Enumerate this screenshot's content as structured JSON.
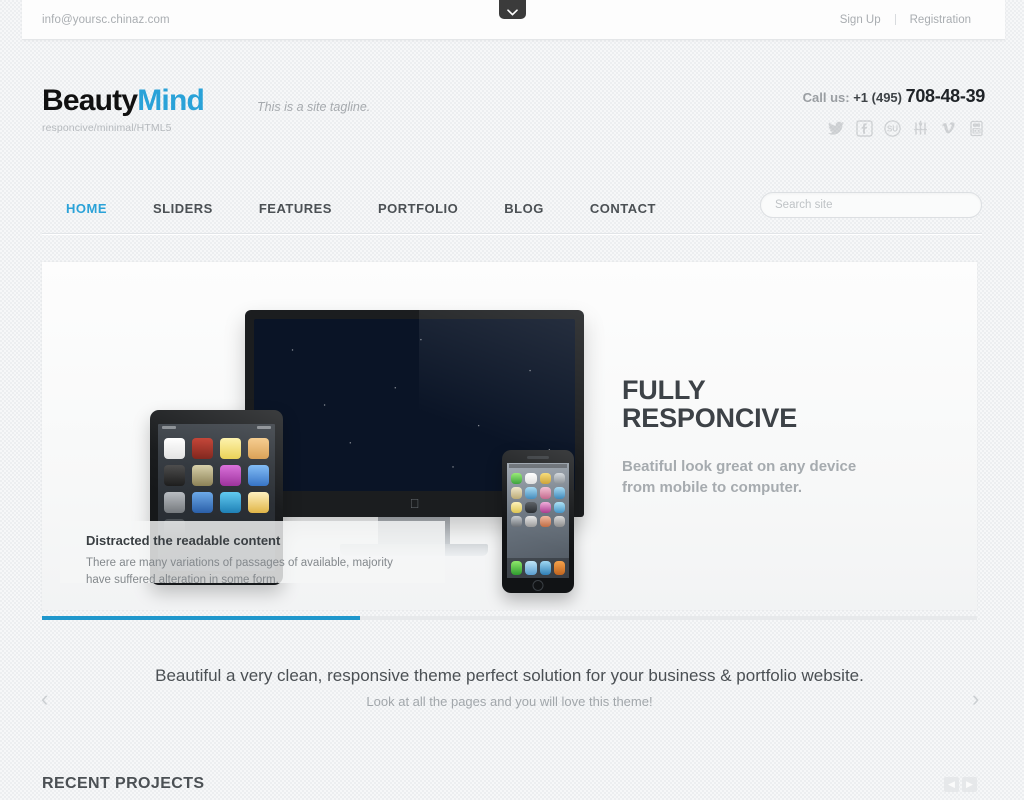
{
  "topbar": {
    "email": "info@yoursc.chinaz.com",
    "sign_up": "Sign Up",
    "registration": "Registration",
    "toggle_icon": "chevron-down-icon"
  },
  "header": {
    "logo_part1": "Beauty",
    "logo_part2": "Mind",
    "logo_sub": "responcive/minimal/HTML5",
    "tagline": "This is a site tagline.",
    "call_label": "Call us:",
    "call_code": "+1 (495)",
    "call_number": "708-48-39",
    "socials": [
      {
        "name": "twitter-icon"
      },
      {
        "name": "facebook-icon"
      },
      {
        "name": "stumbleupon-icon"
      },
      {
        "name": "dribbble-icon"
      },
      {
        "name": "vimeo-icon"
      },
      {
        "name": "youtube-icon"
      }
    ]
  },
  "nav": {
    "items": [
      {
        "label": "HOME",
        "active": true
      },
      {
        "label": "SLIDERS",
        "active": false
      },
      {
        "label": "FEATURES",
        "active": false
      },
      {
        "label": "PORTFOLIO",
        "active": false
      },
      {
        "label": "BLOG",
        "active": false
      },
      {
        "label": "CONTACT",
        "active": false
      }
    ],
    "search_placeholder": "Search site",
    "search_value": ""
  },
  "hero": {
    "title_line1": "FULLY",
    "title_line2": "RESPONCIVE",
    "subtitle_line1": "Beatiful look great on any device",
    "subtitle_line2": "from mobile to computer.",
    "caption_title": "Distracted the readable content",
    "caption_text_line1": "There are many variations of passages of available, majority",
    "caption_text_line2": "have suffered alteration in some form.",
    "progress_percent": 34,
    "devices": {
      "monitor": "imac-display",
      "tablet": "ipad-device",
      "phone": "iphone-device"
    }
  },
  "promo": {
    "line1": "Beautiful a very clean, responsive theme perfect solution for your business & portfolio website.",
    "line2": "Look at all the pages and you will love this theme!",
    "prev_icon": "chevron-left-icon",
    "next_icon": "chevron-right-icon"
  },
  "recent": {
    "title": "RECENT PROJECTS",
    "prev_icon": "chevron-left-icon",
    "next_icon": "chevron-right-icon"
  },
  "colors": {
    "accent": "#2aa2d8",
    "progress": "#1f97cc",
    "dark": "#3b3b3b",
    "text": "#4b5054",
    "muted": "#a6aaae"
  }
}
